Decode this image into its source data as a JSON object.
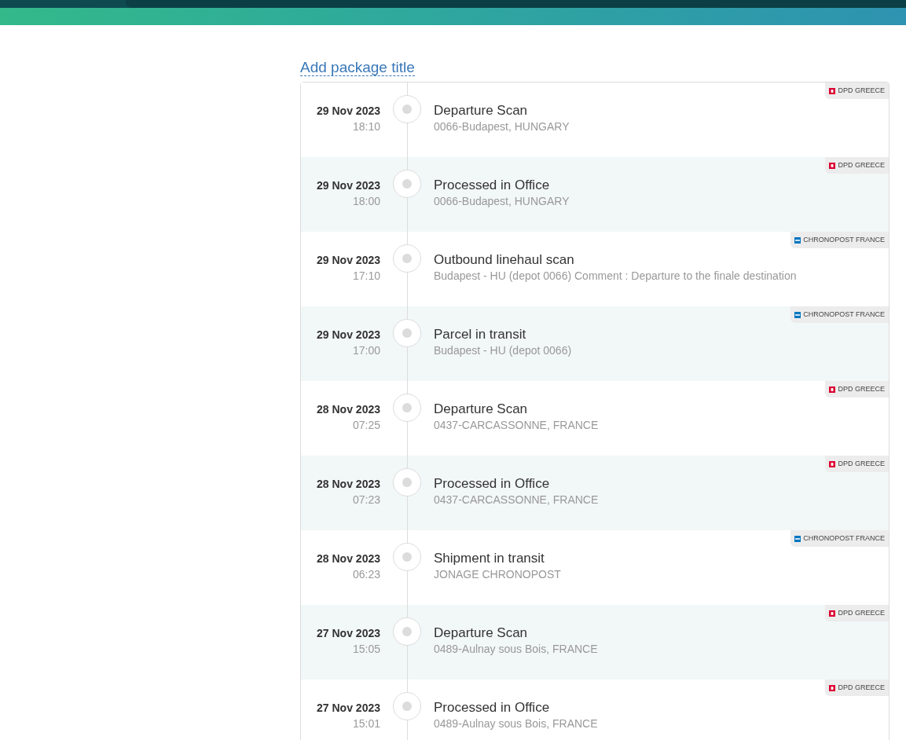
{
  "package_title_link": "Add package title",
  "events": [
    {
      "date": "29 Nov 2023",
      "time": "18:10",
      "title": "Departure Scan",
      "location": "0066-Budapest, HUNGARY",
      "carrier": {
        "kind": "dpd",
        "label": "DPD GREECE"
      }
    },
    {
      "date": "29 Nov 2023",
      "time": "18:00",
      "title": "Processed in Office",
      "location": "0066-Budapest, HUNGARY",
      "carrier": {
        "kind": "dpd",
        "label": "DPD GREECE"
      }
    },
    {
      "date": "29 Nov 2023",
      "time": "17:10",
      "title": "Outbound linehaul scan",
      "location": "Budapest - HU (depot 0066) Comment : Departure to the finale destination",
      "carrier": {
        "kind": "chronopost",
        "label": "CHRONOPOST FRANCE"
      }
    },
    {
      "date": "29 Nov 2023",
      "time": "17:00",
      "title": "Parcel in transit",
      "location": "Budapest - HU (depot 0066)",
      "carrier": {
        "kind": "chronopost",
        "label": "CHRONOPOST FRANCE"
      }
    },
    {
      "date": "28 Nov 2023",
      "time": "07:25",
      "title": "Departure Scan",
      "location": "0437-CARCASSONNE, FRANCE",
      "carrier": {
        "kind": "dpd",
        "label": "DPD GREECE"
      }
    },
    {
      "date": "28 Nov 2023",
      "time": "07:23",
      "title": "Processed in Office",
      "location": "0437-CARCASSONNE, FRANCE",
      "carrier": {
        "kind": "dpd",
        "label": "DPD GREECE"
      }
    },
    {
      "date": "28 Nov 2023",
      "time": "06:23",
      "title": "Shipment in transit",
      "location": "JONAGE CHRONOPOST",
      "carrier": {
        "kind": "chronopost",
        "label": "CHRONOPOST FRANCE"
      }
    },
    {
      "date": "27 Nov 2023",
      "time": "15:05",
      "title": "Departure Scan",
      "location": "0489-Aulnay sous Bois, FRANCE",
      "carrier": {
        "kind": "dpd",
        "label": "DPD GREECE"
      }
    },
    {
      "date": "27 Nov 2023",
      "time": "15:01",
      "title": "Processed in Office",
      "location": "0489-Aulnay sous Bois, FRANCE",
      "carrier": {
        "kind": "dpd",
        "label": "DPD GREECE"
      }
    }
  ]
}
